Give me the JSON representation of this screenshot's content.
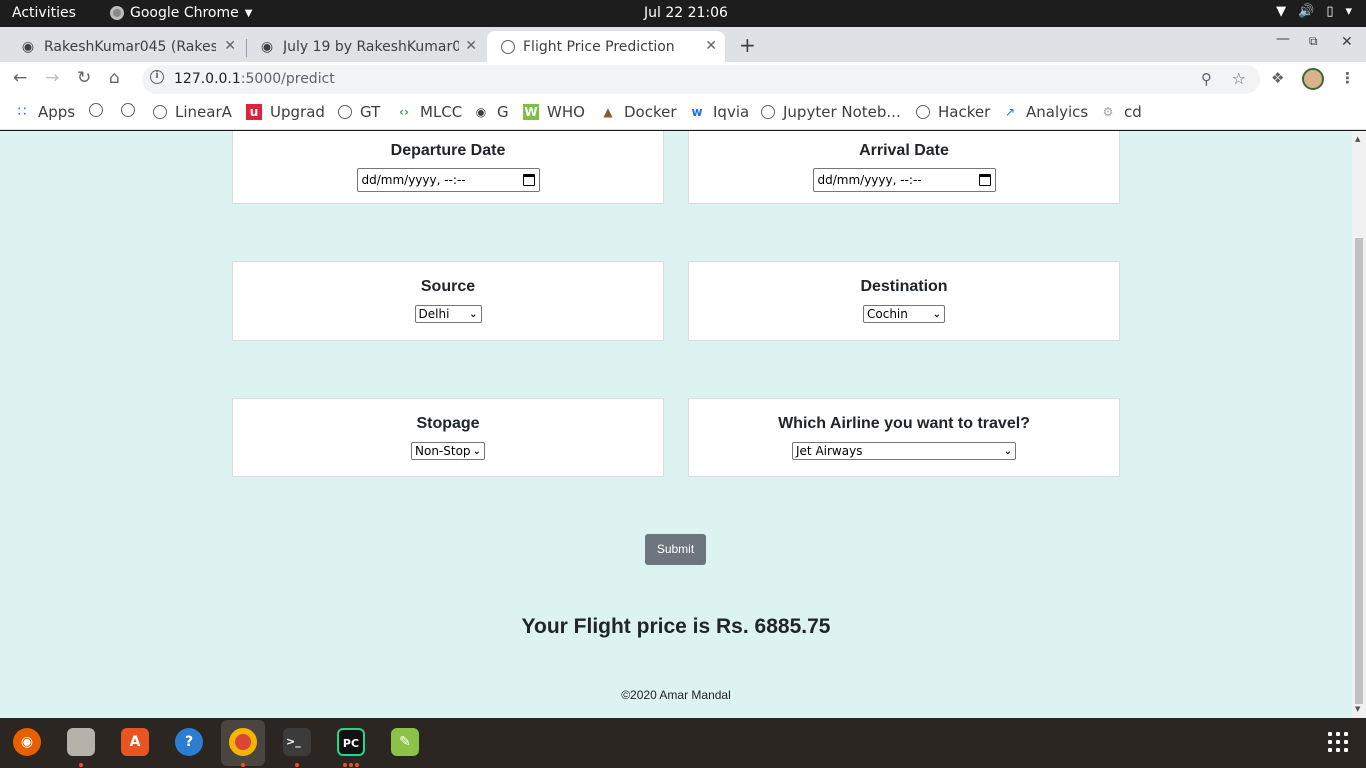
{
  "system": {
    "activities": "Activities",
    "app_menu": "Google Chrome",
    "clock": "Jul 22  21:06"
  },
  "tabs": [
    {
      "title": "RakeshKumar045 (Rakesh",
      "icon": "github-icon",
      "active": false
    },
    {
      "title": "July 19 by RakeshKumar04",
      "icon": "github-icon",
      "active": false
    },
    {
      "title": "Flight Price Prediction",
      "icon": "globe-icon",
      "active": true
    }
  ],
  "toolbar": {
    "url_host": "127.0.0.1",
    "url_path": ":5000/predict"
  },
  "bookmarks": [
    {
      "label": "Apps",
      "icon": "apps-grid-icon"
    },
    {
      "label": "",
      "icon": "globe-icon"
    },
    {
      "label": "",
      "icon": "globe-icon"
    },
    {
      "label": "LinearA",
      "icon": "globe-icon"
    },
    {
      "label": "Upgrad",
      "icon": "upgrad-icon"
    },
    {
      "label": "GT",
      "icon": "globe-icon"
    },
    {
      "label": "MLCC",
      "icon": "mlcc-icon"
    },
    {
      "label": "G",
      "icon": "github-icon"
    },
    {
      "label": "WHO",
      "icon": "who-icon"
    },
    {
      "label": "Docker",
      "icon": "docker-icon"
    },
    {
      "label": "Iqvia",
      "icon": "iqvia-icon"
    },
    {
      "label": "Jupyter Noteb...",
      "icon": "globe-icon"
    },
    {
      "label": "Hacker",
      "icon": "globe-icon"
    },
    {
      "label": "Analyics",
      "icon": "analytics-icon"
    },
    {
      "label": "cd",
      "icon": "gear-icon"
    }
  ],
  "form": {
    "departure_label": "Departure Date",
    "departure_value": "dd/mm/yyyy, --:--",
    "arrival_label": "Arrival Date",
    "arrival_value": "dd/mm/yyyy, --:--",
    "source_label": "Source",
    "source_value": "Delhi",
    "destination_label": "Destination",
    "destination_value": "Cochin",
    "stopage_label": "Stopage",
    "stopage_value": "Non-Stop",
    "airline_label": "Which Airline you want to travel?",
    "airline_value": "Jet Airways",
    "submit_label": "Submit"
  },
  "result": "Your Flight price is Rs. 6885.75",
  "footer": "©2020 Amar Mandal",
  "colors": {
    "page_bg": "#dcf3f1",
    "submit_bg": "#6c757d",
    "topbar_bg": "#1d1d1d"
  }
}
